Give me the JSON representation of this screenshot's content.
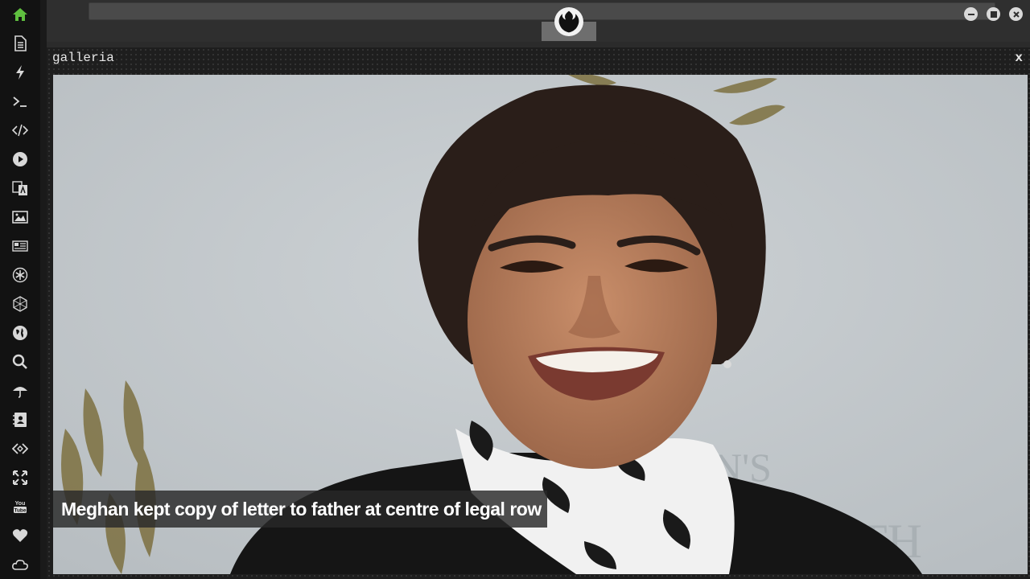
{
  "sidebar": {
    "items": [
      {
        "icon": "home-icon",
        "color": "#5fbf3f"
      },
      {
        "icon": "document-icon"
      },
      {
        "icon": "lightning-icon"
      },
      {
        "icon": "terminal-icon",
        "glyph": ">_"
      },
      {
        "icon": "code-icon"
      },
      {
        "icon": "play-icon"
      },
      {
        "icon": "translate-icon"
      },
      {
        "icon": "image-icon"
      },
      {
        "icon": "newspaper-icon"
      },
      {
        "icon": "asterisk-circle-icon"
      },
      {
        "icon": "hexagon-network-icon"
      },
      {
        "icon": "globe-icon"
      },
      {
        "icon": "search-icon"
      },
      {
        "icon": "umbrella-icon"
      },
      {
        "icon": "contacts-icon"
      },
      {
        "icon": "api-icon"
      },
      {
        "icon": "fullscreen-icon"
      },
      {
        "icon": "youtube-icon",
        "text": "You Tube"
      },
      {
        "icon": "heart-icon"
      },
      {
        "icon": "cloud-icon"
      }
    ]
  },
  "window": {
    "logo_icon": "rebel-alliance-icon",
    "buttons": [
      "minimize-icon",
      "maximize-icon",
      "close-icon"
    ]
  },
  "panel": {
    "title": "galleria",
    "close_label": "x"
  },
  "gallery": {
    "caption": "Meghan kept copy of letter to father at centre of legal row"
  }
}
